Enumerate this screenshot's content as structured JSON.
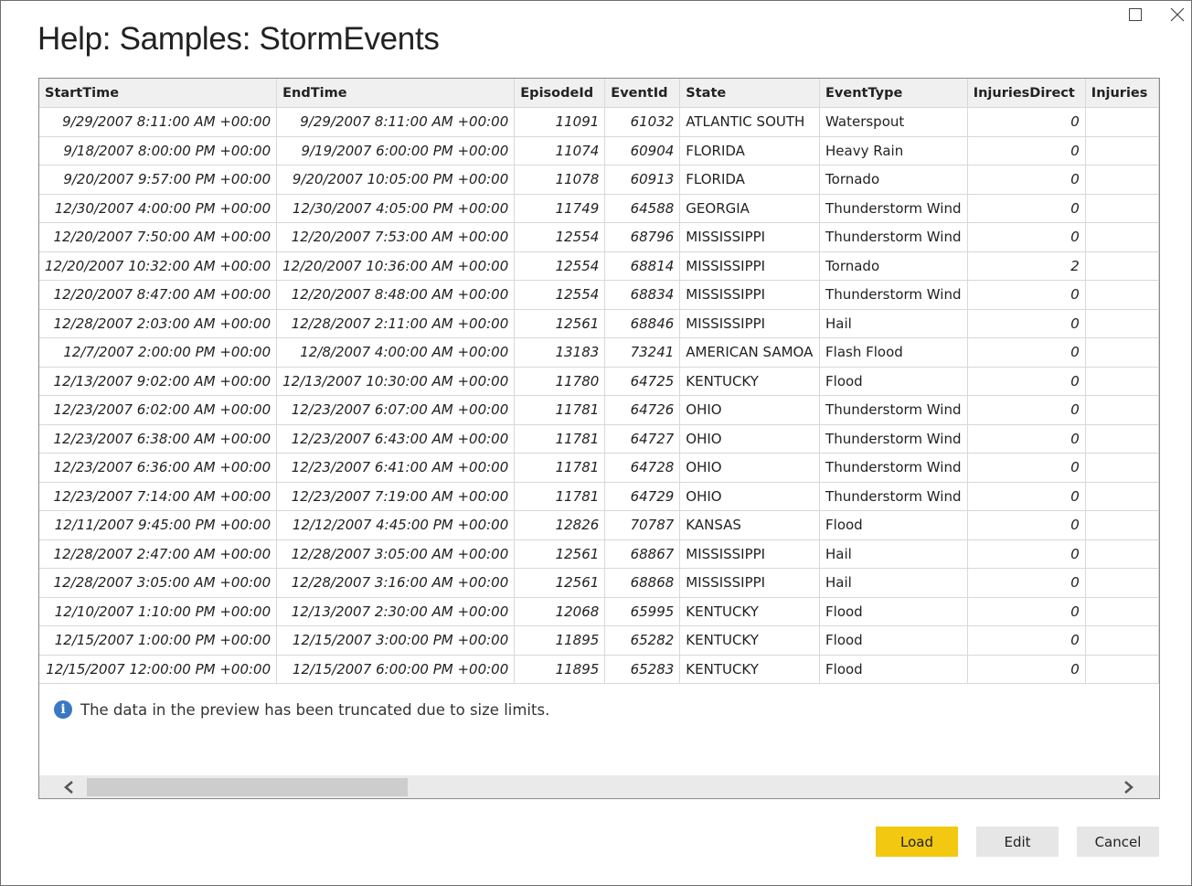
{
  "window": {
    "title": "Help: Samples: StormEvents"
  },
  "table": {
    "columns": [
      "StartTime",
      "EndTime",
      "EpisodeId",
      "EventId",
      "State",
      "EventType",
      "InjuriesDirect",
      "Injuries"
    ],
    "rows": [
      [
        "9/29/2007 8:11:00 AM +00:00",
        "9/29/2007 8:11:00 AM +00:00",
        "11091",
        "61032",
        "ATLANTIC SOUTH",
        "Waterspout",
        "0",
        ""
      ],
      [
        "9/18/2007 8:00:00 PM +00:00",
        "9/19/2007 6:00:00 PM +00:00",
        "11074",
        "60904",
        "FLORIDA",
        "Heavy Rain",
        "0",
        ""
      ],
      [
        "9/20/2007 9:57:00 PM +00:00",
        "9/20/2007 10:05:00 PM +00:00",
        "11078",
        "60913",
        "FLORIDA",
        "Tornado",
        "0",
        ""
      ],
      [
        "12/30/2007 4:00:00 PM +00:00",
        "12/30/2007 4:05:00 PM +00:00",
        "11749",
        "64588",
        "GEORGIA",
        "Thunderstorm Wind",
        "0",
        ""
      ],
      [
        "12/20/2007 7:50:00 AM +00:00",
        "12/20/2007 7:53:00 AM +00:00",
        "12554",
        "68796",
        "MISSISSIPPI",
        "Thunderstorm Wind",
        "0",
        ""
      ],
      [
        "12/20/2007 10:32:00 AM +00:00",
        "12/20/2007 10:36:00 AM +00:00",
        "12554",
        "68814",
        "MISSISSIPPI",
        "Tornado",
        "2",
        ""
      ],
      [
        "12/20/2007 8:47:00 AM +00:00",
        "12/20/2007 8:48:00 AM +00:00",
        "12554",
        "68834",
        "MISSISSIPPI",
        "Thunderstorm Wind",
        "0",
        ""
      ],
      [
        "12/28/2007 2:03:00 AM +00:00",
        "12/28/2007 2:11:00 AM +00:00",
        "12561",
        "68846",
        "MISSISSIPPI",
        "Hail",
        "0",
        ""
      ],
      [
        "12/7/2007 2:00:00 PM +00:00",
        "12/8/2007 4:00:00 AM +00:00",
        "13183",
        "73241",
        "AMERICAN SAMOA",
        "Flash Flood",
        "0",
        ""
      ],
      [
        "12/13/2007 9:02:00 AM +00:00",
        "12/13/2007 10:30:00 AM +00:00",
        "11780",
        "64725",
        "KENTUCKY",
        "Flood",
        "0",
        ""
      ],
      [
        "12/23/2007 6:02:00 AM +00:00",
        "12/23/2007 6:07:00 AM +00:00",
        "11781",
        "64726",
        "OHIO",
        "Thunderstorm Wind",
        "0",
        ""
      ],
      [
        "12/23/2007 6:38:00 AM +00:00",
        "12/23/2007 6:43:00 AM +00:00",
        "11781",
        "64727",
        "OHIO",
        "Thunderstorm Wind",
        "0",
        ""
      ],
      [
        "12/23/2007 6:36:00 AM +00:00",
        "12/23/2007 6:41:00 AM +00:00",
        "11781",
        "64728",
        "OHIO",
        "Thunderstorm Wind",
        "0",
        ""
      ],
      [
        "12/23/2007 7:14:00 AM +00:00",
        "12/23/2007 7:19:00 AM +00:00",
        "11781",
        "64729",
        "OHIO",
        "Thunderstorm Wind",
        "0",
        ""
      ],
      [
        "12/11/2007 9:45:00 PM +00:00",
        "12/12/2007 4:45:00 PM +00:00",
        "12826",
        "70787",
        "KANSAS",
        "Flood",
        "0",
        ""
      ],
      [
        "12/28/2007 2:47:00 AM +00:00",
        "12/28/2007 3:05:00 AM +00:00",
        "12561",
        "68867",
        "MISSISSIPPI",
        "Hail",
        "0",
        ""
      ],
      [
        "12/28/2007 3:05:00 AM +00:00",
        "12/28/2007 3:16:00 AM +00:00",
        "12561",
        "68868",
        "MISSISSIPPI",
        "Hail",
        "0",
        ""
      ],
      [
        "12/10/2007 1:10:00 PM +00:00",
        "12/13/2007 2:30:00 AM +00:00",
        "12068",
        "65995",
        "KENTUCKY",
        "Flood",
        "0",
        ""
      ],
      [
        "12/15/2007 1:00:00 PM +00:00",
        "12/15/2007 3:00:00 PM +00:00",
        "11895",
        "65282",
        "KENTUCKY",
        "Flood",
        "0",
        ""
      ],
      [
        "12/15/2007 12:00:00 PM +00:00",
        "12/15/2007 6:00:00 PM +00:00",
        "11895",
        "65283",
        "KENTUCKY",
        "Flood",
        "0",
        ""
      ]
    ]
  },
  "notice": {
    "icon": "info-icon",
    "text": "The data in the preview has been truncated due to size limits."
  },
  "buttons": {
    "load": "Load",
    "edit": "Edit",
    "cancel": "Cancel"
  },
  "colors": {
    "accent_load": "#f2c811",
    "info_icon": "#3a78c2"
  }
}
